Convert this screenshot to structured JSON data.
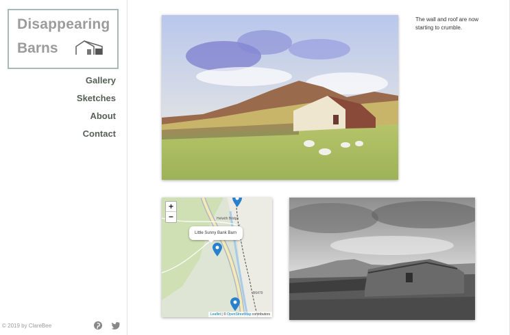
{
  "sidebar": {
    "logo": {
      "line1": "Disappearing",
      "line2": "Barns"
    },
    "nav": [
      {
        "label": "Gallery"
      },
      {
        "label": "Sketches"
      },
      {
        "label": "About"
      },
      {
        "label": "Contact"
      }
    ],
    "copyright": "© 2019 by ClareBee",
    "social": [
      {
        "icon": "pinterest-icon"
      },
      {
        "icon": "twitter-icon"
      }
    ]
  },
  "main": {
    "caption": "The wall and roof are now starting to crumble.",
    "map": {
      "zoom_in": "+",
      "zoom_out": "−",
      "popup_label": "Little Sunny Bank Barn",
      "popup_close": "×",
      "place_label": "Helwith Bridge",
      "road_label": "B6479",
      "attribution": {
        "leaflet": "Leaflet",
        "separator": " | © ",
        "osm": "OpenStreetMap",
        "contributors": " contributors"
      }
    }
  },
  "colors": {
    "logo_text": "#9b9b9b",
    "logo_border": "#a8b8b8",
    "nav_text": "#555f55",
    "marker": "#2a81cb"
  }
}
